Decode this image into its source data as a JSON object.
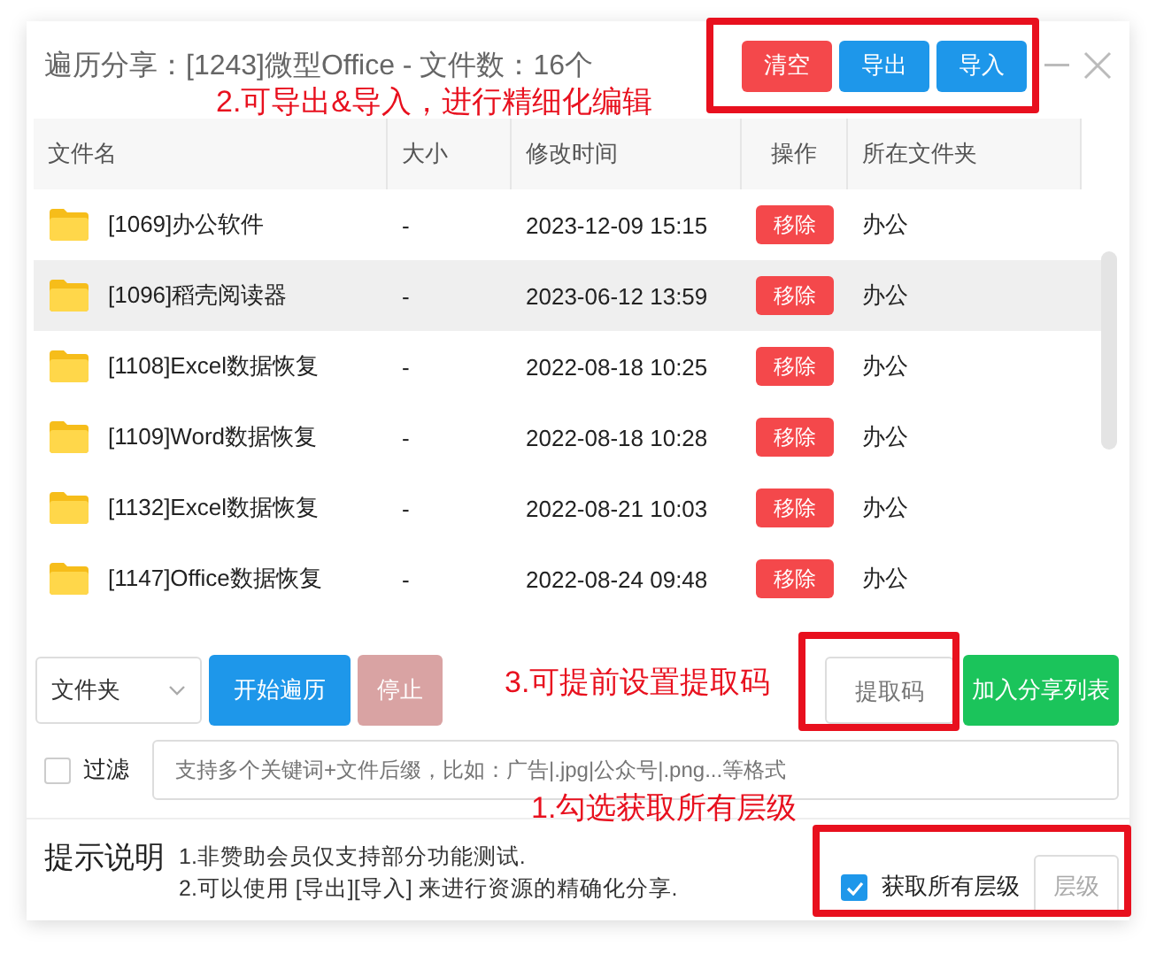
{
  "window": {
    "title": "遍历分享：[1243]微型Office - 文件数：16个"
  },
  "header_buttons": [
    {
      "label": "清空",
      "kind": "danger"
    },
    {
      "label": "导出",
      "kind": "primary"
    },
    {
      "label": "导入",
      "kind": "primary"
    }
  ],
  "table": {
    "columns": [
      "文件名",
      "大小",
      "修改时间",
      "操作",
      "所在文件夹"
    ],
    "rows": [
      {
        "name": "[1069]办公软件",
        "size": "-",
        "modified": "2023-12-09 15:15",
        "action": "移除",
        "folder": "办公",
        "selected": false
      },
      {
        "name": "[1096]稻壳阅读器",
        "size": "-",
        "modified": "2023-06-12 13:59",
        "action": "移除",
        "folder": "办公",
        "selected": true
      },
      {
        "name": "[1108]Excel数据恢复",
        "size": "-",
        "modified": "2022-08-18 10:25",
        "action": "移除",
        "folder": "办公",
        "selected": false
      },
      {
        "name": "[1109]Word数据恢复",
        "size": "-",
        "modified": "2022-08-18 10:28",
        "action": "移除",
        "folder": "办公",
        "selected": false
      },
      {
        "name": "[1132]Excel数据恢复",
        "size": "-",
        "modified": "2022-08-21 10:03",
        "action": "移除",
        "folder": "办公",
        "selected": false
      },
      {
        "name": "[1147]Office数据恢复",
        "size": "-",
        "modified": "2022-08-24 09:48",
        "action": "移除",
        "folder": "办公",
        "selected": false
      }
    ]
  },
  "controls": {
    "type_select": "文件夹",
    "start_button": "开始遍历",
    "stop_button": {
      "label": "停止",
      "disabled": true
    },
    "code_field": {
      "placeholder": "提取码"
    },
    "add_button": "加入分享列表"
  },
  "filter": {
    "label": "过滤",
    "checked": false,
    "placeholder": "支持多个关键词+文件后缀，比如：广告|.jpg|公众号|.png...等格式"
  },
  "hints": {
    "title": "提示说明",
    "lines": [
      "1.非赞助会员仅支持部分功能测试.",
      "2.可以使用 [导出][导入] 来进行资源的精确化分享."
    ]
  },
  "all_levels": {
    "label": "获取所有层级",
    "checked": true,
    "button": "层级"
  },
  "annotations": [
    "2.可导出&导入，进行精细化编辑",
    "3.可提前设置提取码",
    "1.勾选获取所有层级"
  ]
}
